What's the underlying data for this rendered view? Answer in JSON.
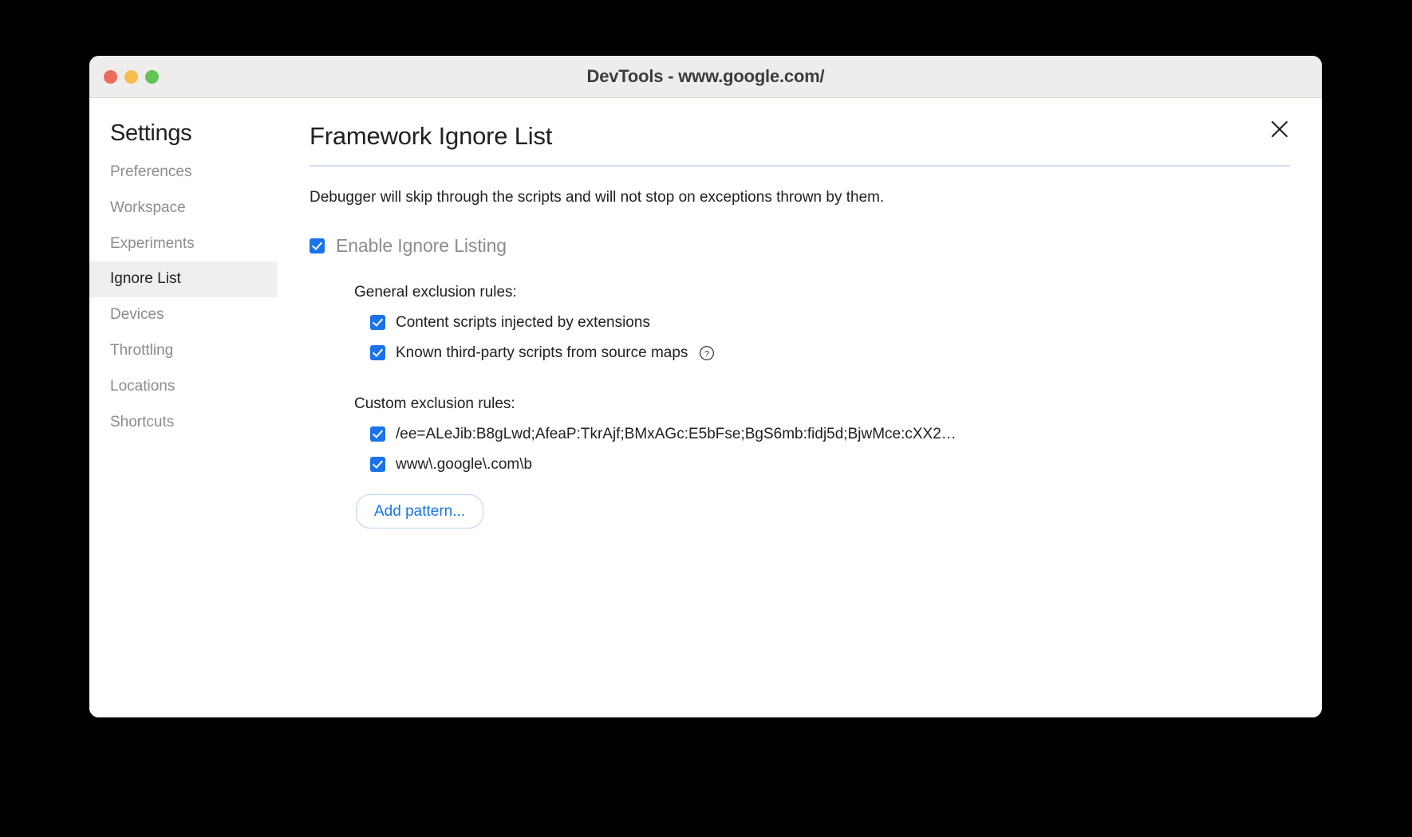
{
  "window": {
    "title": "DevTools - www.google.com/",
    "traffic_lights": [
      {
        "name": "close",
        "color": "#ee6a5f"
      },
      {
        "name": "minimize",
        "color": "#f5bd4f"
      },
      {
        "name": "maximize",
        "color": "#61c454"
      }
    ]
  },
  "sidebar": {
    "title": "Settings",
    "items": [
      {
        "label": "Preferences",
        "selected": false
      },
      {
        "label": "Workspace",
        "selected": false
      },
      {
        "label": "Experiments",
        "selected": false
      },
      {
        "label": "Ignore List",
        "selected": true
      },
      {
        "label": "Devices",
        "selected": false
      },
      {
        "label": "Throttling",
        "selected": false
      },
      {
        "label": "Locations",
        "selected": false
      },
      {
        "label": "Shortcuts",
        "selected": false
      }
    ]
  },
  "main": {
    "close_icon": "close-icon",
    "title": "Framework Ignore List",
    "description": "Debugger will skip through the scripts and will not stop on exceptions thrown by them.",
    "enable": {
      "label": "Enable Ignore Listing",
      "checked": true
    },
    "general_section": {
      "heading": "General exclusion rules:",
      "rules": [
        {
          "label": "Content scripts injected by extensions",
          "checked": true,
          "help": false
        },
        {
          "label": "Known third-party scripts from source maps",
          "checked": true,
          "help": true
        }
      ]
    },
    "custom_section": {
      "heading": "Custom exclusion rules:",
      "rules": [
        {
          "label": "/ee=ALeJib:B8gLwd;AfeaP:TkrAjf;BMxAGc:E5bFse;BgS6mb:fidj5d;BjwMce:cXX2…",
          "checked": true
        },
        {
          "label": "www\\.google\\.com\\b",
          "checked": true
        }
      ]
    },
    "add_pattern_label": "Add pattern..."
  },
  "colors": {
    "accent": "#1a73e8",
    "divider": "#d3dff5",
    "selected_bg": "#efefef",
    "muted_text": "#8a8c8e",
    "text": "#202124",
    "titlebar": "#eeedeb"
  }
}
